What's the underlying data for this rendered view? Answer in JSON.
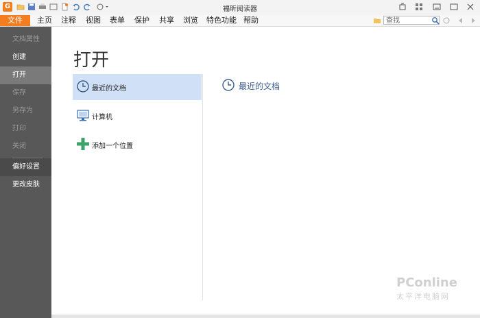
{
  "titlebar": {
    "app_logo_text": "G",
    "title": "福昕阅读器",
    "quick_access_icons": [
      "open-icon",
      "save-icon",
      "print-icon",
      "scan-icon",
      "new-icon",
      "undo-icon",
      "redo-icon",
      "hand-tool-icon"
    ],
    "window_controls": [
      "restore-icon",
      "grid-icon",
      "minimize-icon",
      "maximize-icon",
      "close-icon"
    ]
  },
  "menubar": {
    "file_tab": "文件",
    "items": [
      "主页",
      "注释",
      "视图",
      "表单",
      "保护",
      "共享",
      "浏览",
      "特色功能",
      "帮助"
    ],
    "search_placeholder": "查找"
  },
  "sidebar": {
    "items": [
      {
        "label": "文档属性",
        "state": "disabled"
      },
      {
        "label": "创建",
        "state": "enabled"
      },
      {
        "label": "打开",
        "state": "active"
      },
      {
        "label": "保存",
        "state": "disabled"
      },
      {
        "label": "另存为",
        "state": "disabled"
      },
      {
        "label": "打印",
        "state": "disabled"
      },
      {
        "label": "关闭",
        "state": "disabled"
      },
      {
        "label": "偏好设置",
        "state": "shaded"
      },
      {
        "label": "更改皮肤",
        "state": "enabled"
      }
    ]
  },
  "main": {
    "title": "打开",
    "locations": [
      {
        "label": "最近的文档",
        "icon": "clock-icon",
        "selected": true
      },
      {
        "label": "计算机",
        "icon": "computer-icon",
        "selected": false
      },
      {
        "label": "添加一个位置",
        "icon": "plus-icon",
        "selected": false
      }
    ],
    "right_heading": "最近的文档"
  },
  "watermark": {
    "main": "PConline",
    "sub": "太平洋电脑网"
  },
  "colors": {
    "accent": "#f57c1f",
    "sidebar": "#585858",
    "selected": "#cfe0f7",
    "heading": "#3c5d8a"
  }
}
